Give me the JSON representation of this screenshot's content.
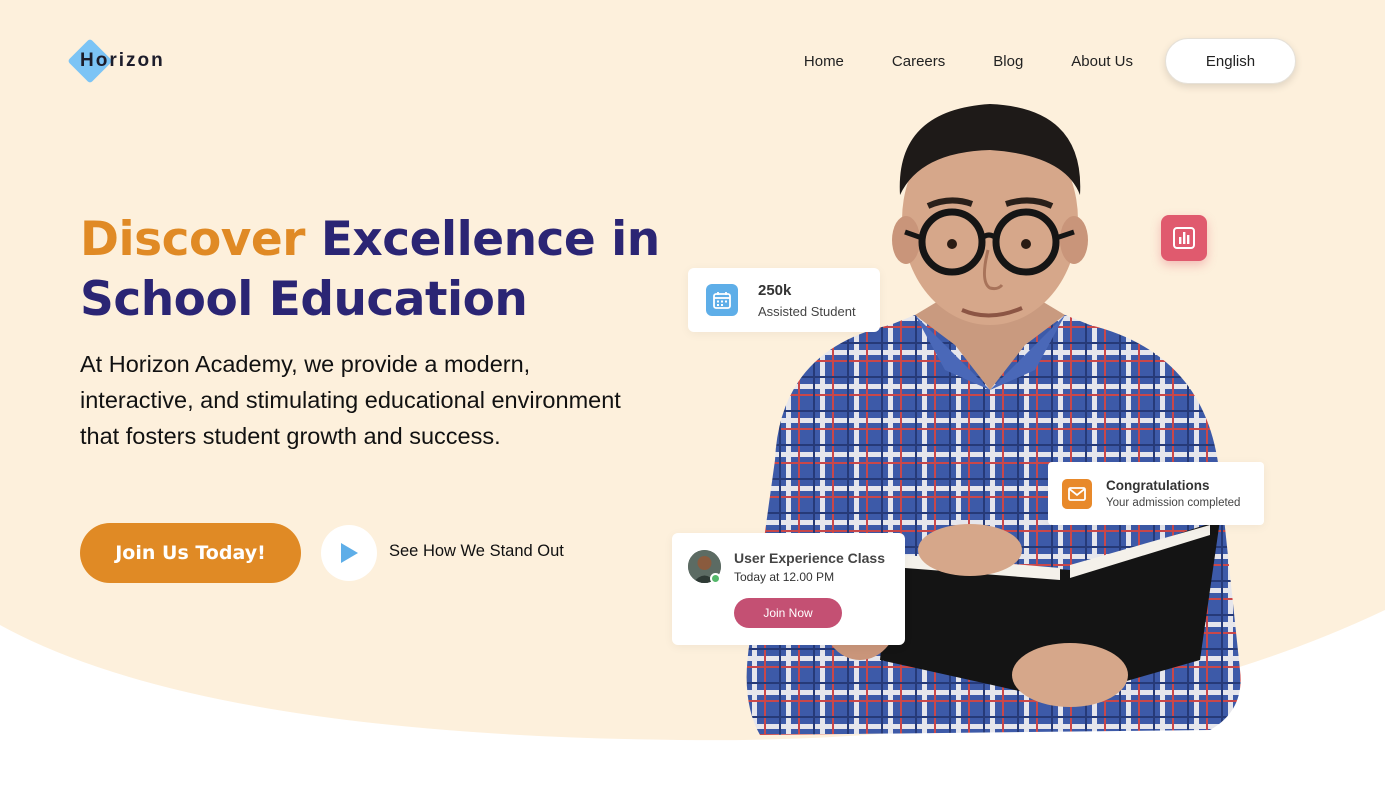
{
  "brand": {
    "name": "Horizon"
  },
  "nav": {
    "items": [
      "Home",
      "Careers",
      "Blog",
      "About Us"
    ],
    "language": "English"
  },
  "hero": {
    "headline_accent": "Discover",
    "headline_rest": "Excellence in School Education",
    "description": "At Horizon Academy, we provide a modern, interactive, and stimulating educational environment that fosters student growth and success.",
    "cta_primary": "Join Us Today!",
    "cta_secondary": "See How We Stand Out"
  },
  "cards": {
    "stat": {
      "value": "250k",
      "label": "Assisted Student",
      "icon": "calendar-icon"
    },
    "congrats": {
      "title": "Congratulations",
      "subtitle": "Your admission completed",
      "icon": "mail-icon"
    },
    "class": {
      "title": "User Experience Class",
      "time": "Today at 12.00 PM",
      "button": "Join Now",
      "online": true
    },
    "badge": {
      "icon": "bar-chart-icon"
    }
  },
  "colors": {
    "background": "#fdf0dc",
    "accent_orange": "#e08a25",
    "heading_navy": "#2b2574",
    "brand_blue": "#7cc4f5",
    "join_now_pink": "#c45073",
    "badge_red": "#e05a6e"
  }
}
